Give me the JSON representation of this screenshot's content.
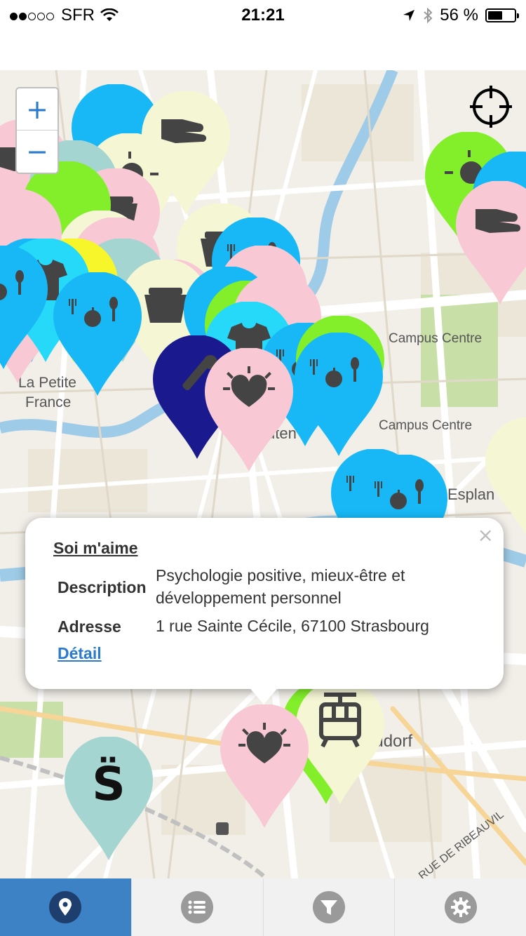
{
  "status_bar": {
    "carrier": "SFR",
    "time": "21:21",
    "battery_text": "56 %",
    "battery_level": 0.56,
    "signal_bars_filled": 2,
    "signal_bars_total": 5
  },
  "map": {
    "labels": {
      "petite_france_1": "La Petite",
      "petite_france_2": "France",
      "campus_centre_1": "Campus Centre",
      "campus_centre_2": "Campus Centre",
      "esplanade": "Esplan",
      "neudorf": "eudorf",
      "rue_ribeauville": "RUE DE RIBEAUVIL",
      "center_fragment": "uten"
    },
    "zoom_in": "+",
    "zoom_out": "−"
  },
  "popup": {
    "title": "Soi m'aime",
    "close": "×",
    "description_label": "Description",
    "description_line1": "Psychologie positive, mieux-être et",
    "description_line2": "développement personnel",
    "address_label": "Adresse",
    "address_value": "1 rue Sainte Cécile, 67100 Strasbourg",
    "detail_link": "Détail"
  },
  "markers_glyph": {
    "s_marker": "S̈"
  },
  "colors": {
    "pink": "#f8c8d4",
    "blue": "#17b8f5",
    "cream": "#f5f6d4",
    "green": "#82ef2a",
    "navy": "#1a1a8e",
    "teal": "#a5d5d0",
    "yellow": "#f7f62a",
    "tab_active": "#3e82c6"
  },
  "tabbar": {
    "tabs": [
      "map-icon",
      "list-icon",
      "filter-icon",
      "settings-icon"
    ],
    "active_index": 0
  }
}
